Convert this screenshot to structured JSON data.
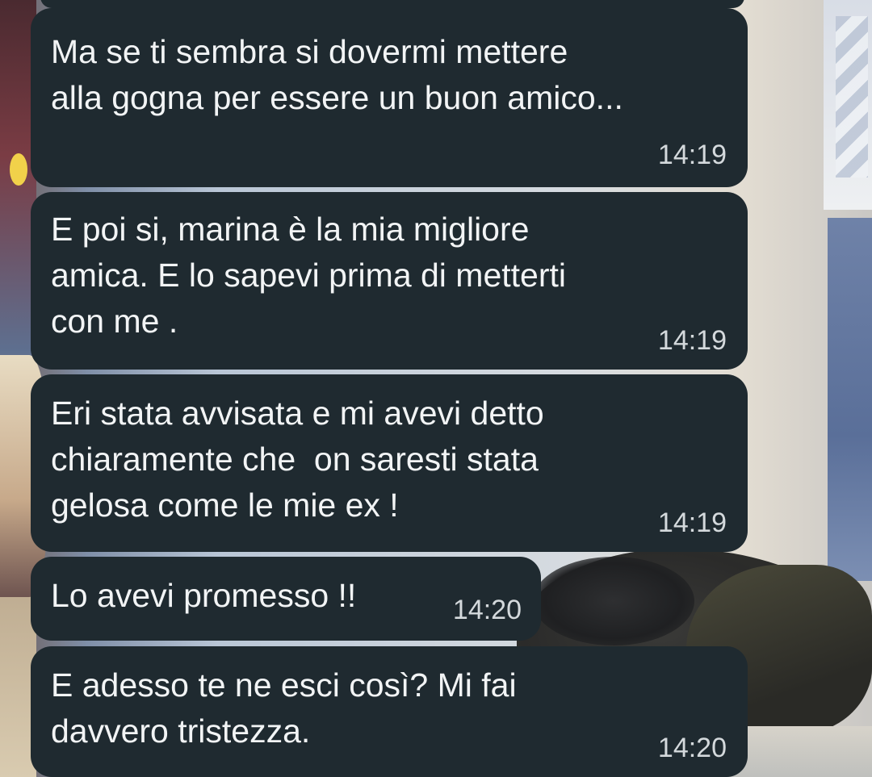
{
  "chat": {
    "messages": [
      {
        "lines": [
          "Ma se ti sembra si dovermi mettere",
          "alla gogna per essere un buon amico..."
        ],
        "time": "14:19"
      },
      {
        "lines": [
          "E poi si, marina è la mia migliore",
          "amica. E lo sapevi prima di metterti",
          "con me ."
        ],
        "time": "14:19"
      },
      {
        "lines": [
          "Eri stata avvisata e mi avevi detto",
          "chiaramente che  on saresti stata",
          "gelosa come le mie ex !"
        ],
        "time": "14:19"
      },
      {
        "lines": [
          "Lo avevi promesso !!"
        ],
        "time": "14:20"
      },
      {
        "lines": [
          "E adesso te ne esci così? Mi fai",
          "davvero tristezza."
        ],
        "time": "14:20"
      }
    ]
  },
  "colors": {
    "bubble": "#1f2a30",
    "text": "#f2f4f5",
    "time": "#d4d9dc"
  }
}
